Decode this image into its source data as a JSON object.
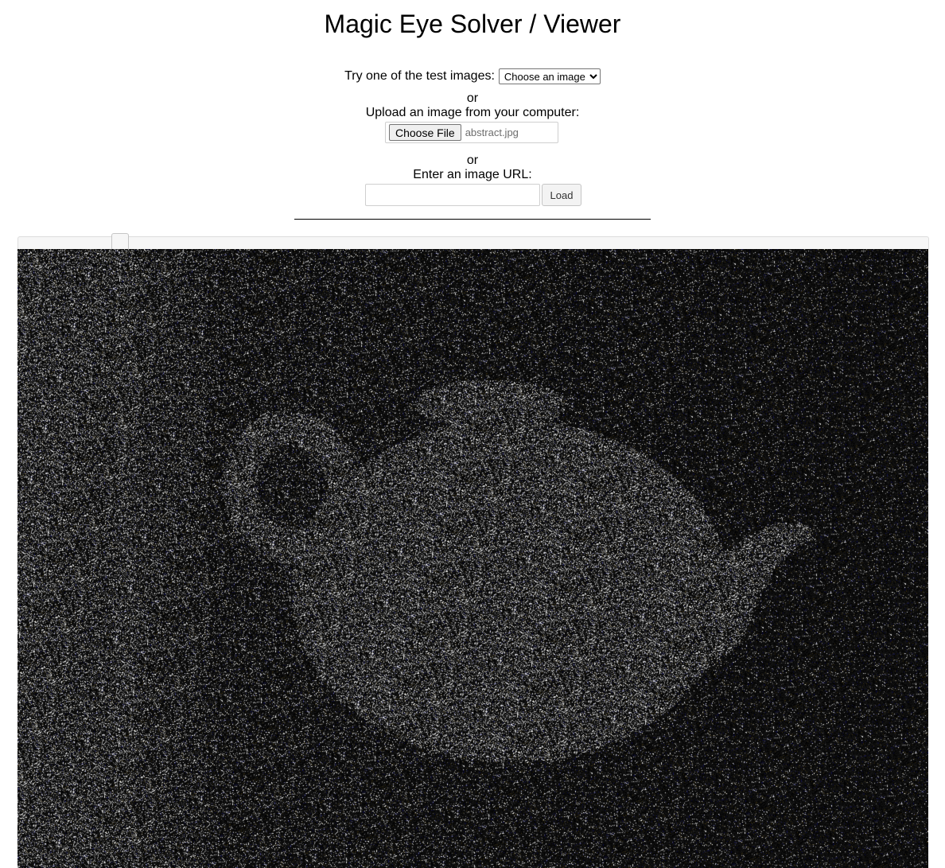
{
  "page": {
    "title": "Magic Eye Solver / Viewer"
  },
  "test_images": {
    "label": "Try one of the test images:",
    "select_value": "Choose an image"
  },
  "upload": {
    "or_text": "or",
    "label": "Upload an image from your computer:",
    "button_label": "Choose File",
    "file_name": "abstract.jpg"
  },
  "url": {
    "or_text": "or",
    "label": "Enter an image URL:",
    "value": "",
    "load_label": "Load"
  },
  "offset_slider": {
    "level": 0.105
  },
  "viewer": {
    "image_alt": "teapot-stereogram"
  }
}
